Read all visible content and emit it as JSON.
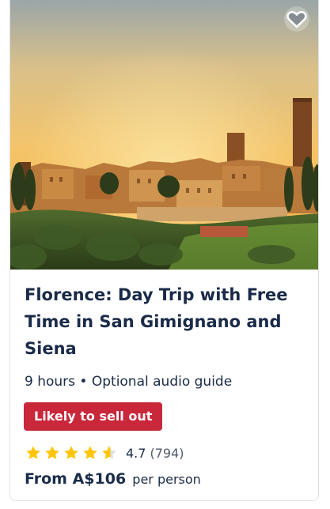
{
  "card": {
    "image_alt": "San Gimignano towers at sunset",
    "title": "Florence: Day Trip with Free Time in San Gimignano and Siena",
    "meta": "9 hours • Optional audio guide",
    "badge": "Likely to sell out",
    "rating": {
      "score": "4.7",
      "count": "(794)",
      "stars_value": 4.7,
      "stars_max": 5
    },
    "price": {
      "amount": "From A$106",
      "unit": "per person"
    }
  },
  "colors": {
    "title": "#1a2b49",
    "badge": "#c9283b",
    "star": "#ffc50a"
  },
  "icons": {
    "wishlist": "heart-outline-icon",
    "star": "star-icon"
  }
}
